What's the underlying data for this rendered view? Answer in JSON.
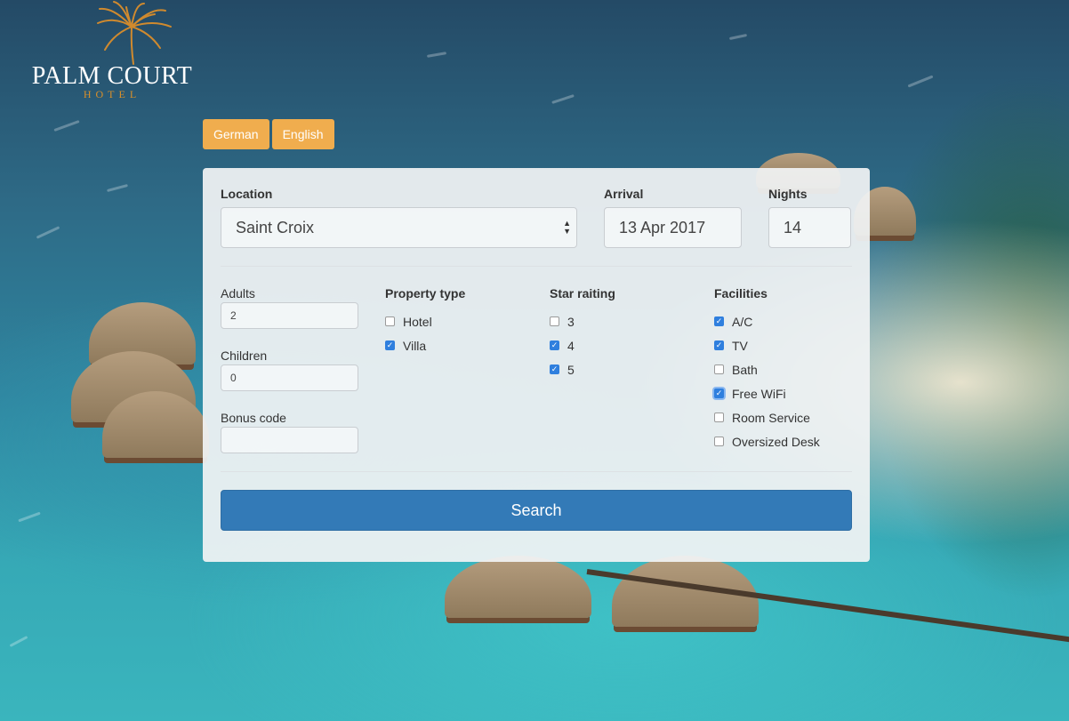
{
  "brand": {
    "name": "PALM COURT",
    "subtitle": "HOTEL"
  },
  "languages": [
    "German",
    "English"
  ],
  "form": {
    "location": {
      "label": "Location",
      "value": "Saint Croix"
    },
    "arrival": {
      "label": "Arrival",
      "value": "13 Apr 2017"
    },
    "nights": {
      "label": "Nights",
      "value": "14"
    },
    "adults": {
      "label": "Adults",
      "value": "2"
    },
    "children": {
      "label": "Children",
      "value": "0"
    },
    "bonus_code": {
      "label": "Bonus code",
      "value": ""
    },
    "property_type": {
      "title": "Property type",
      "options": [
        {
          "label": "Hotel",
          "checked": false
        },
        {
          "label": "Villa",
          "checked": true
        }
      ]
    },
    "star_rating": {
      "title": "Star raiting",
      "options": [
        {
          "label": "3",
          "checked": false
        },
        {
          "label": "4",
          "checked": true
        },
        {
          "label": "5",
          "checked": true
        }
      ]
    },
    "facilities": {
      "title": "Facilities",
      "options": [
        {
          "label": "A/C",
          "checked": true
        },
        {
          "label": "TV",
          "checked": true
        },
        {
          "label": "Bath",
          "checked": false
        },
        {
          "label": "Free WiFi",
          "checked": true,
          "focused": true
        },
        {
          "label": "Room Service",
          "checked": false
        },
        {
          "label": "Oversized Desk",
          "checked": false
        }
      ]
    },
    "search_label": "Search"
  },
  "colors": {
    "accent": "#337ab7",
    "language_button": "#f0ad4e",
    "logo_gold": "#d9902a"
  }
}
